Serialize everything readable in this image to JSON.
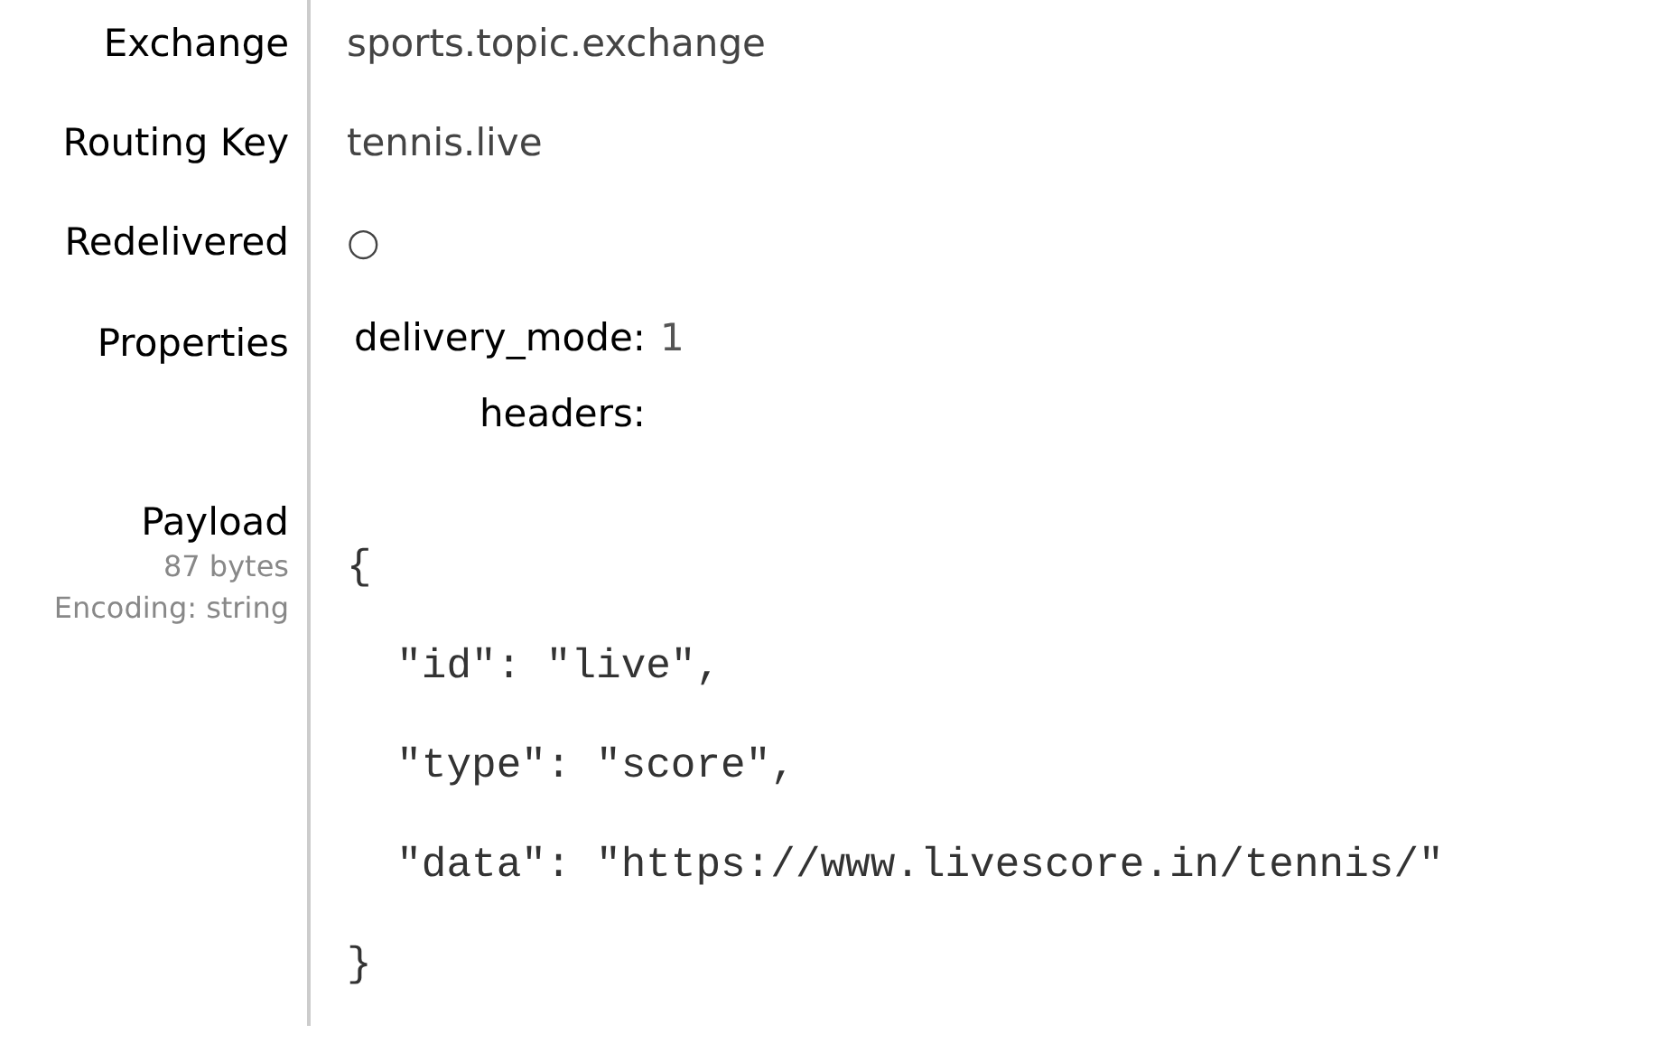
{
  "fields": [
    {
      "label": "Exchange",
      "value": "sports.topic.exchange"
    },
    {
      "label": "Routing Key",
      "value": "tennis.live"
    },
    {
      "label": "Redelivered",
      "value": "○"
    }
  ],
  "properties": {
    "label": "Properties",
    "entries": [
      {
        "key": "delivery_mode:",
        "value": "1"
      },
      {
        "key": "headers:"
      }
    ]
  },
  "payload": {
    "label": "Payload",
    "size": "87 bytes",
    "encoding": "Encoding: string",
    "lines": [
      "{",
      "  \"id\": \"live\",",
      "  \"type\": \"score\",",
      "  \"data\": \"https://www.livescore.in/tennis/\"",
      "}"
    ]
  }
}
